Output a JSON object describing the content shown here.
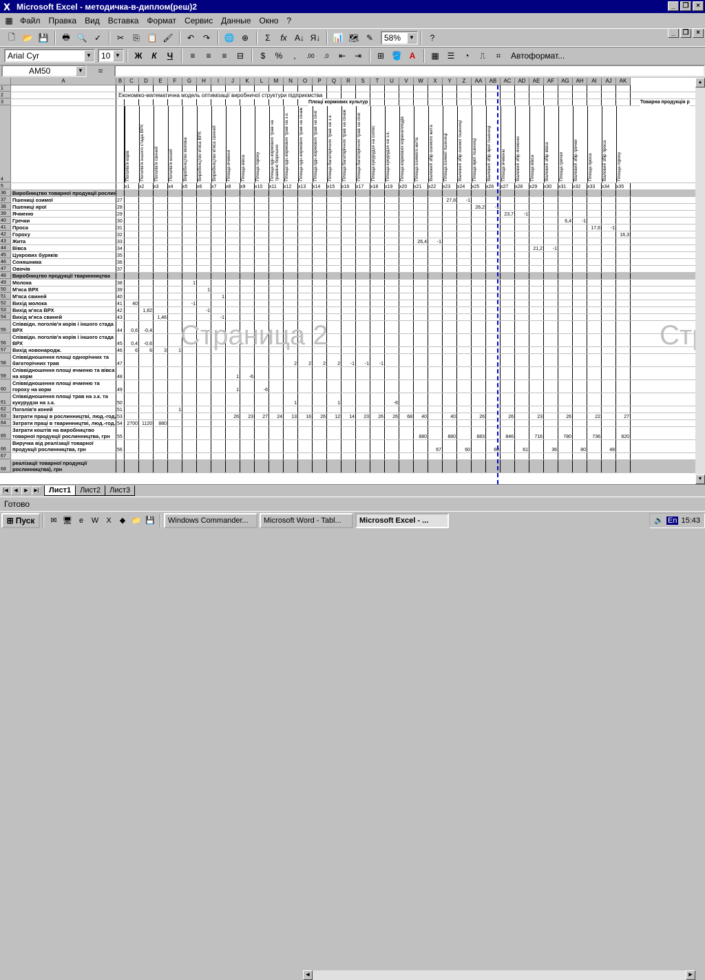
{
  "window": {
    "title": "Microsoft Excel - методичка-в-диплом(реш)2"
  },
  "menu": [
    "Файл",
    "Правка",
    "Вид",
    "Вставка",
    "Формат",
    "Сервис",
    "Данные",
    "Окно",
    "?"
  ],
  "toolbar": {
    "zoom": "58%",
    "font": "Arial Cyr",
    "size": "10",
    "autoformat": "Автоформат..."
  },
  "namebox": "AM50",
  "formula_eq": "=",
  "columns": [
    "A",
    "B",
    "C",
    "D",
    "E",
    "F",
    "G",
    "H",
    "I",
    "J",
    "K",
    "L",
    "M",
    "N",
    "O",
    "P",
    "Q",
    "R",
    "S",
    "T",
    "U",
    "V",
    "W",
    "X",
    "Y",
    "Z",
    "AA",
    "AB",
    "AC",
    "AD",
    "AE",
    "AF",
    "AG",
    "AH",
    "AI",
    "AJ",
    "AK"
  ],
  "sheet": {
    "r2_title": "Економіко-математична модель оптимізації виробничої структури підприємства",
    "r3_crops": "Площі кормових культур",
    "r3_products": "Товарна продукція р",
    "r4_headers": [
      "Поголів'я корів",
      "Поголів'я іншого стада ВРХ",
      "Поголів'я свиней",
      "Поголів'я коней",
      "Виробництво молока",
      "Виробництво м'яса ВРХ",
      "Виробництво м'яса свиней",
      "Площа ячменя",
      "Площа вівса",
      "Площа гороху",
      "Площа одн.кормових трав на травяне борошно",
      "Площа одн.кормових трав на з.к.",
      "Площа одн.кормових трав на сінаж",
      "Площа одн.кормових трав на сіно",
      "Площа багаторічних трав на з.к.",
      "Площа багаторічних трав на сінаж",
      "Площа багаторічних трав на сіно",
      "Площа кукурудзи на силос",
      "Площа кукурудзи на з.к.",
      "Площа кормових коренеплодів",
      "Площа озимого жита",
      "Валовий збір озимого жита",
      "Площа озимої пшениці",
      "Валовий збір озимої пшениці",
      "Площа ярої пшениці",
      "Валовий збір ярої пшениці",
      "Площа ячменю",
      "Валовий збір ячменю",
      "Площа вівса",
      "Валовий збір вівса",
      "Площа гречки",
      "Валовий збір гречки",
      "Площа проса",
      "Валовий збір проса",
      "Площа гороху"
    ],
    "r5_vars": [
      "x1",
      "x2",
      "x3",
      "x4",
      "x5",
      "x6",
      "x7",
      "x8",
      "x9",
      "x10",
      "x11",
      "x12",
      "x13",
      "x14",
      "x15",
      "x16",
      "x17",
      "x18",
      "x19",
      "x20",
      "x21",
      "x22",
      "x23",
      "x24",
      "x25",
      "x26",
      "x27",
      "x28",
      "x29",
      "x30",
      "x31",
      "x32",
      "x33",
      "x34",
      "x35"
    ],
    "rows": [
      {
        "n": "1",
        "a": "",
        "b": "",
        "c": []
      },
      {
        "n": "2",
        "a": "",
        "b": "",
        "c": []
      },
      {
        "n": "3",
        "a": "",
        "b": "",
        "c": []
      },
      {
        "n": "4",
        "a": "",
        "b": "",
        "c": []
      },
      {
        "n": "5",
        "a": "",
        "b": "",
        "c": []
      },
      {
        "n": "36",
        "a": "Виробництво товарної продукції рослинництва:",
        "b": "",
        "c": [],
        "gray": true
      },
      {
        "n": "37",
        "a": "Пшениці озимої",
        "b": "27",
        "c": {
          "23": "27,8",
          "24": "-1"
        }
      },
      {
        "n": "38",
        "a": "Пшениці ярої",
        "b": "28",
        "c": {
          "25": "26,2",
          "26": "-1"
        }
      },
      {
        "n": "39",
        "a": "Ячменю",
        "b": "29",
        "c": {
          "27": "23,7",
          "28": "-1"
        }
      },
      {
        "n": "40",
        "a": "Гречки",
        "b": "30",
        "c": {
          "31": "6,4",
          "32": "-1"
        }
      },
      {
        "n": "41",
        "a": "Проса",
        "b": "31",
        "c": {
          "33": "17,6",
          "34": "-1"
        }
      },
      {
        "n": "42",
        "a": "Гороху",
        "b": "32",
        "c": {
          "35": "16,3"
        }
      },
      {
        "n": "43",
        "a": "Жита",
        "b": "33",
        "c": {
          "21": "26,4",
          "22": "-1"
        }
      },
      {
        "n": "44",
        "a": "Вівса",
        "b": "34",
        "c": {
          "29": "21,2",
          "30": "-1"
        }
      },
      {
        "n": "45",
        "a": "Цукрових буряків",
        "b": "35",
        "c": {}
      },
      {
        "n": "46",
        "a": "Соняшника",
        "b": "36",
        "c": {}
      },
      {
        "n": "47",
        "a": "Овочів",
        "b": "37",
        "c": {}
      },
      {
        "n": "48",
        "a": "Виробництво продукції тваринництва",
        "b": "",
        "c": [],
        "gray": true
      },
      {
        "n": "49",
        "a": "Молока",
        "b": "38",
        "c": {
          "5": "1"
        }
      },
      {
        "n": "50",
        "a": "М'яса ВРХ",
        "b": "39",
        "c": {
          "6": "1"
        }
      },
      {
        "n": "51",
        "a": "М'яса свиней",
        "b": "40",
        "c": {
          "7": "1"
        }
      },
      {
        "n": "52",
        "a": "Вихід молока",
        "b": "41",
        "c": {
          "1": "40",
          "5": "-1"
        }
      },
      {
        "n": "53",
        "a": "Вихід м'яса ВРХ",
        "b": "42",
        "c": {
          "2": "1,82",
          "6": "-1"
        }
      },
      {
        "n": "54",
        "a": "Вихід м'яса свиней",
        "b": "43",
        "c": {
          "3": "1,46",
          "7": "-1"
        }
      },
      {
        "n": "55",
        "a": "Співвідн. поголів'я корів і іншого стада ВРХ",
        "b": "44",
        "c": {
          "1": "0,6",
          "2": "-0,4"
        },
        "tall": true
      },
      {
        "n": "56",
        "a": "Співвідн. поголів'я корів і іншого стада ВРХ",
        "b": "45",
        "c": {
          "1": "0,4",
          "2": "-0,6"
        },
        "tall": true
      },
      {
        "n": "57",
        "a": "Вихід новонародж.",
        "b": "46",
        "c": {
          "1": "6",
          "2": "6",
          "3": "3",
          "4": "1"
        }
      },
      {
        "n": "58",
        "a": "Співвідношення площі однорічних та багаторічних трав",
        "b": "47",
        "c": {
          "12": "2",
          "13": "2",
          "14": "2",
          "15": "2",
          "16": "-1",
          "17": "-1",
          "18": "-1"
        },
        "tall": true
      },
      {
        "n": "59",
        "a": "Співвідношення площі ячменю та вівса на корм",
        "b": "48",
        "c": {
          "8": "1",
          "9": "-6"
        },
        "tall": true
      },
      {
        "n": "60",
        "a": "Співвідношення площі ячменю та гороху на корм",
        "b": "49",
        "c": {
          "8": "1",
          "10": "-6"
        },
        "tall": true
      },
      {
        "n": "61",
        "a": "Співвідношення площі трав на з.к. та кукурудзи на з.к.",
        "b": "50",
        "c": {
          "12": "1",
          "15": "1",
          "19": "-6"
        },
        "tall": true
      },
      {
        "n": "62",
        "a": "Поголів'я коней",
        "b": "51",
        "c": {
          "4": "1"
        }
      },
      {
        "n": "63",
        "a": "Затрати праці в рослинництві, люд.-год.",
        "b": "53",
        "c": {
          "8": "26",
          "9": "23",
          "10": "27",
          "11": "24",
          "12": "13",
          "13": "16",
          "14": "26",
          "15": "12",
          "16": "14",
          "17": "23",
          "18": "26",
          "19": "26",
          "20": "68",
          "21": "40",
          "23": "40",
          "25": "26",
          "27": "26",
          "29": "23",
          "31": "26",
          "33": "22",
          "35": "27"
        }
      },
      {
        "n": "64",
        "a": "Затрати праці в тваринництві, люд.-год.",
        "b": "54",
        "c": {
          "1": "2700",
          "2": "1120",
          "3": "880"
        }
      },
      {
        "n": "65",
        "a": "Затрати коштів на виробництво товарної продукції рослинництва, грн",
        "b": "55",
        "c": {
          "21": "880",
          "23": "880",
          "25": "883",
          "27": "846",
          "29": "716",
          "31": "780",
          "33": "736",
          "35": "820"
        },
        "tall": true
      },
      {
        "n": "66",
        "a": "Виручка від реалізації товарної продукції рослинництва, грн",
        "b": "56",
        "c": {
          "22": "67",
          "24": "60",
          "26": "60",
          "28": "61",
          "30": "36",
          "32": "80",
          "34": "48"
        },
        "tall": true
      },
      {
        "n": "67",
        "a": "",
        "b": "",
        "c": {}
      },
      {
        "n": "68",
        "a": "Цільова функція (прибуток від реалізації товарної продукції рослинництва), грн",
        "b": "",
        "c": [],
        "gray": true,
        "tall": true
      }
    ]
  },
  "watermarks": [
    "Страница 2",
    "Стр"
  ],
  "tabs": [
    "Лист1",
    "Лист2",
    "Лист3"
  ],
  "status": "Готово",
  "taskbar": {
    "start": "Пуск",
    "tasks": [
      "Windows Commander...",
      "Microsoft Word - Tabl...",
      "Microsoft Excel - ..."
    ],
    "lang": "En",
    "time": "15:43"
  }
}
